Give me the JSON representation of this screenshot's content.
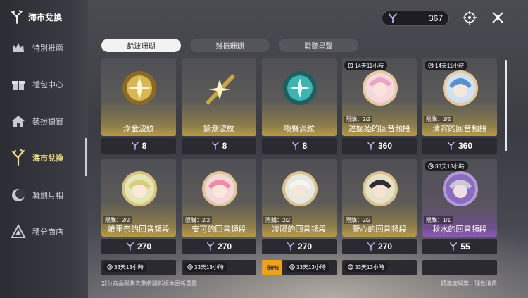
{
  "brand": {
    "title": "海市兌換"
  },
  "sidebar": {
    "items": [
      {
        "label": "特別推薦",
        "icon": "crown-icon"
      },
      {
        "label": "禮包中心",
        "icon": "gift-icon"
      },
      {
        "label": "裝扮櫥窗",
        "icon": "house-icon"
      },
      {
        "label": "海市兌換",
        "icon": "coral-icon"
      },
      {
        "label": "凝劍月相",
        "icon": "moon-icon"
      },
      {
        "label": "積分商店",
        "icon": "triangle-icon"
      }
    ]
  },
  "currency": {
    "amount": "367"
  },
  "tabs": [
    "餘波珊瑚",
    "殘振珊瑚",
    "聆聽星聲"
  ],
  "items": [
    {
      "name": "浮金波紋",
      "price": "8",
      "badge": "",
      "limit": "",
      "art": "gold-orb"
    },
    {
      "name": "鑄潮波紋",
      "price": "8",
      "badge": "",
      "limit": "",
      "art": "gold-blade"
    },
    {
      "name": "喚聲渦紋",
      "price": "8",
      "badge": "",
      "limit": "",
      "art": "teal-orb"
    },
    {
      "name": "達妮婭的回音頻段",
      "price": "360",
      "badge": "14天11小時",
      "limit": "限購：2/2",
      "art": "pink-char"
    },
    {
      "name": "清宵的回音頻段",
      "price": "360",
      "badge": "14天11小時",
      "limit": "限購：2/2",
      "art": "blue-char"
    },
    {
      "name": "維里奈的回音頻段",
      "price": "270",
      "badge": "",
      "limit": "限購：2/2",
      "art": "green-char"
    },
    {
      "name": "安可的回音頻段",
      "price": "270",
      "badge": "",
      "limit": "限購：2/2",
      "art": "pinkhair-char"
    },
    {
      "name": "凌陽的回音頻段",
      "price": "270",
      "badge": "",
      "limit": "限購：2/2",
      "art": "white-char"
    },
    {
      "name": "鑒心的回音頻段",
      "price": "270",
      "badge": "",
      "limit": "限購：2/2",
      "art": "dark-char"
    },
    {
      "name": "秋水的回音頻段",
      "price": "55",
      "badge": "33天13小時",
      "limit": "限購：1/1",
      "art": "purple-char"
    }
  ],
  "bottom": [
    {
      "badge": "33天13小時",
      "discount": ""
    },
    {
      "badge": "33天13小時",
      "discount": ""
    },
    {
      "badge": "33天13小時",
      "discount": "-50%"
    },
    {
      "badge": "33天13小時",
      "discount": ""
    },
    {
      "badge": "",
      "discount": ""
    }
  ],
  "footer": {
    "left": "部分商品限購次數將隨新版本更新重置",
    "right": "請適度娛樂，理性消費"
  },
  "colors": {
    "gold": "#b79a47",
    "purple": "#8c5ab8",
    "discount": "#f0a020"
  }
}
